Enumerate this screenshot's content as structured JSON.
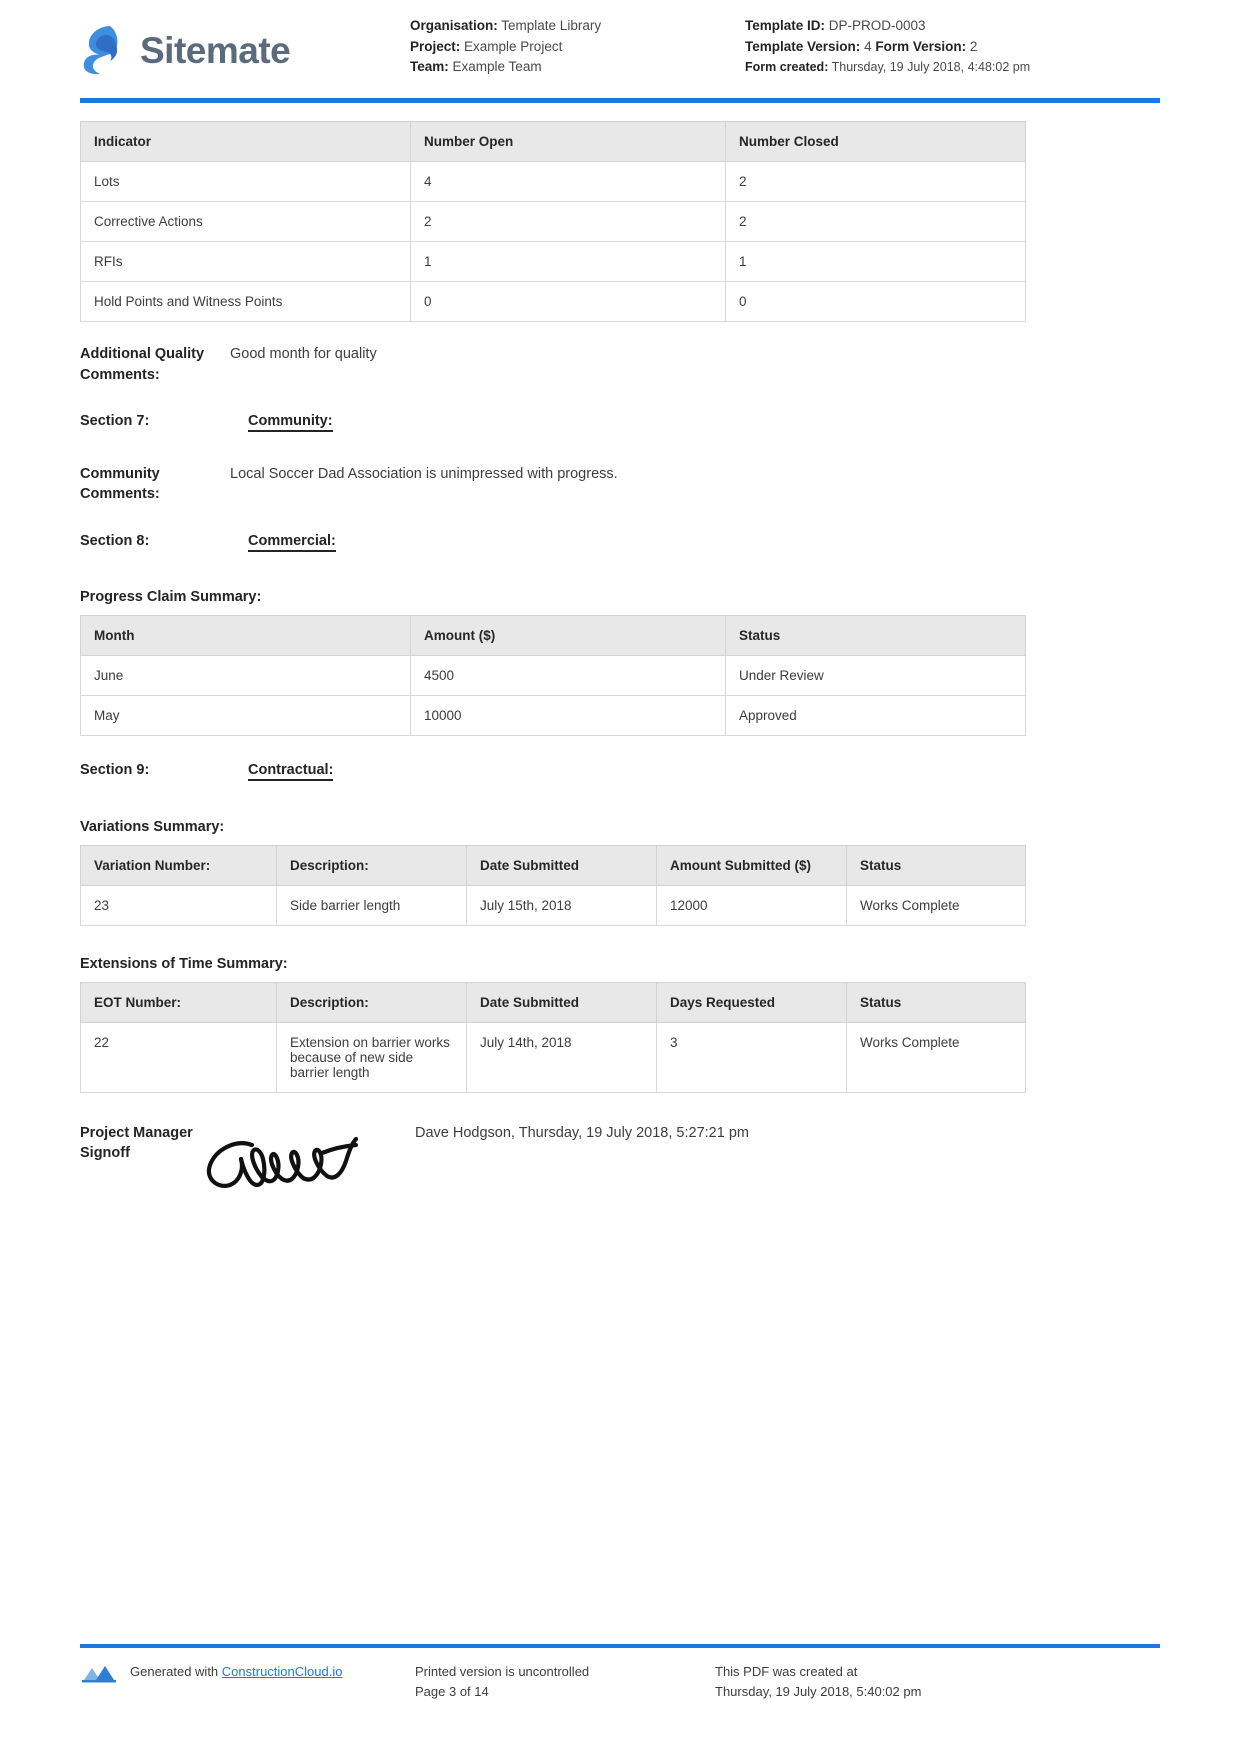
{
  "brand": {
    "name": "Sitemate",
    "logo_icon": "sitemate-logo-icon"
  },
  "header": {
    "left": [
      {
        "label": "Organisation:",
        "value": "Template Library"
      },
      {
        "label": "Project:",
        "value": "Example Project"
      },
      {
        "label": "Team:",
        "value": "Example Team"
      }
    ],
    "right": {
      "template_id_label": "Template ID:",
      "template_id_value": "DP-PROD-0003",
      "template_version_label": "Template Version:",
      "template_version_value": "4",
      "form_version_label": "Form Version:",
      "form_version_value": "2",
      "form_created_label": "Form created:",
      "form_created_value": "Thursday, 19 July 2018, 4:48:02 pm"
    }
  },
  "indicator_table": {
    "headers": [
      "Indicator",
      "Number Open",
      "Number Closed"
    ],
    "rows": [
      [
        "Lots",
        "4",
        "2"
      ],
      [
        "Corrective Actions",
        "2",
        "2"
      ],
      [
        "RFIs",
        "1",
        "1"
      ],
      [
        "Hold Points and Witness Points",
        "0",
        "0"
      ]
    ]
  },
  "additional_quality_comments": {
    "label": "Additional Quality Comments:",
    "value": "Good month for quality"
  },
  "section7": {
    "label": "Section 7:",
    "title": "Community:"
  },
  "community_comments": {
    "label": "Community Comments:",
    "value": "Local Soccer Dad Association is unimpressed with progress."
  },
  "section8": {
    "label": "Section 8:",
    "title": "Commercial:"
  },
  "progress_claim": {
    "heading": "Progress Claim Summary:",
    "headers": [
      "Month",
      "Amount ($)",
      "Status"
    ],
    "rows": [
      [
        "June",
        "4500",
        "Under Review"
      ],
      [
        "May",
        "10000",
        "Approved"
      ]
    ]
  },
  "section9": {
    "label": "Section 9:",
    "title": "Contractual:"
  },
  "variations": {
    "heading": "Variations Summary:",
    "headers": [
      "Variation Number:",
      "Description:",
      "Date Submitted",
      "Amount Submitted ($)",
      "Status"
    ],
    "rows": [
      [
        "23",
        "Side barrier length",
        "July 15th, 2018",
        "12000",
        "Works Complete"
      ]
    ]
  },
  "eot": {
    "heading": "Extensions of Time Summary:",
    "headers": [
      "EOT Number:",
      "Description:",
      "Date Submitted",
      "Days Requested",
      "Status"
    ],
    "rows": [
      [
        "22",
        "Extension on barrier works because of new side barrier length",
        "July 14th, 2018",
        "3",
        "Works Complete"
      ]
    ]
  },
  "signoff": {
    "label": "Project Manager Signoff",
    "value": "Dave Hodgson, Thursday, 19 July 2018, 5:27:21 pm",
    "signature_icon": "handwritten-signature-icon"
  },
  "footer": {
    "generated_prefix": "Generated with ",
    "generated_link": "ConstructionCloud.io",
    "uncontrolled_text": "Printed version is uncontrolled",
    "page_text": "Page 3 of 14",
    "created_at_label": "This PDF was created at",
    "created_at_value": "Thursday, 19 July 2018, 5:40:02 pm",
    "logo_icon": "constructioncloud-logo-icon"
  },
  "colors": {
    "accent_blue": "#1b7ae0",
    "header_grey": "#e8e8e8",
    "brand_grey": "#5b6b7c"
  }
}
